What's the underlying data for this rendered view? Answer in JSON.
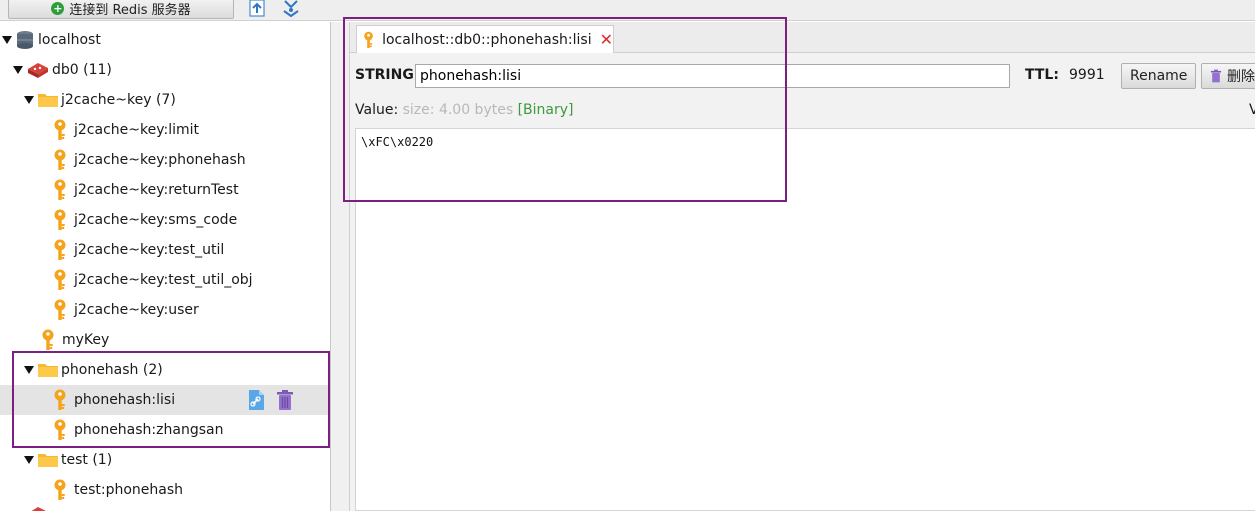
{
  "toolbar": {
    "connect_label": "连接到 Redis 服务器"
  },
  "tree": {
    "server": "localhost",
    "db": "db0  (11)",
    "items": [
      {
        "label": "j2cache~key (7)",
        "kind": "folder"
      },
      {
        "label": "j2cache~key:limit",
        "kind": "key"
      },
      {
        "label": "j2cache~key:phonehash",
        "kind": "key"
      },
      {
        "label": "j2cache~key:returnTest",
        "kind": "key"
      },
      {
        "label": "j2cache~key:sms_code",
        "kind": "key"
      },
      {
        "label": "j2cache~key:test_util",
        "kind": "key"
      },
      {
        "label": "j2cache~key:test_util_obj",
        "kind": "key"
      },
      {
        "label": "j2cache~key:user",
        "kind": "key"
      },
      {
        "label": "myKey",
        "kind": "key"
      },
      {
        "label": "phonehash (2)",
        "kind": "folder"
      },
      {
        "label": "phonehash:lisi",
        "kind": "key",
        "selected": true
      },
      {
        "label": "phonehash:zhangsan",
        "kind": "key"
      },
      {
        "label": "test (1)",
        "kind": "folder"
      },
      {
        "label": "test:phonehash",
        "kind": "key"
      }
    ]
  },
  "tab": {
    "title": "localhost::db0::phonehash:lisi",
    "close": "✕"
  },
  "detail": {
    "type_label": "STRING:",
    "key_value": "phonehash:lisi",
    "ttl_label": "TTL:",
    "ttl_value": "9991",
    "rename_label": "Rename",
    "delete_label": "删除",
    "value_label": "Value:",
    "value_size": "size: 4.00 bytes",
    "value_format": "[Binary]",
    "value_right_char": "V",
    "value_content": "\\xFC\\x0220"
  },
  "colors": {
    "highlight_border": "#7b1f83",
    "key_icon": "#f5a31a",
    "folder_icon": "#f7b733",
    "binary_green": "#3d9a3d",
    "close_red": "#e0282a"
  }
}
